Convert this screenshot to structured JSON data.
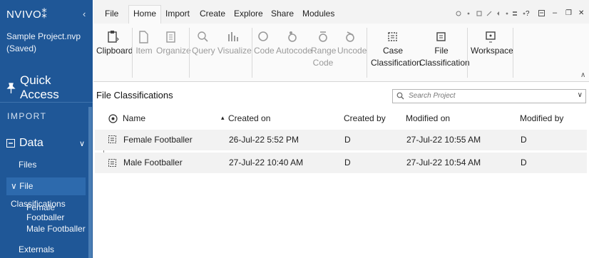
{
  "app": {
    "logo": "NVIVO",
    "logo_mark": "⁑",
    "collapse_glyph": "‹",
    "project_name": "Sample Project.nvp",
    "project_state": "(Saved)"
  },
  "sidebar": {
    "quick_access": "Quick Access",
    "section_import": "IMPORT",
    "data_label": "Data",
    "items": [
      {
        "label": "Files"
      },
      {
        "label": "File Classifications",
        "prefix": "∨"
      },
      {
        "label": "Female Footballer"
      },
      {
        "label": "Male Footballer"
      },
      {
        "label": "Externals"
      }
    ]
  },
  "ribbon": {
    "tabs": [
      {
        "label": "File"
      },
      {
        "label": "Home"
      },
      {
        "label": "Import"
      },
      {
        "label": "Create"
      },
      {
        "label": "Explore"
      },
      {
        "label": "Share"
      },
      {
        "label": "Modules"
      }
    ],
    "active_tab": "Home",
    "buttons": {
      "clipboard": "Clipboard",
      "item": "Item",
      "organize": "Organize",
      "query": "Query",
      "visualize": "Visualize",
      "code": "Code",
      "autocode": "Autocode",
      "range_code_1": "Range",
      "range_code_2": "Code",
      "uncode": "Uncode",
      "case_class_1": "Case",
      "case_class_2": "Classification",
      "file_class_1": "File",
      "file_class_2": "Classification",
      "workspace": "Workspace"
    },
    "window_controls": {
      "help": "?",
      "minimize": "–",
      "restore": "❐",
      "close": "✕"
    }
  },
  "content": {
    "title": "File Classifications",
    "search_placeholder": "Search Project",
    "columns": {
      "name": "Name",
      "created_on": "Created on",
      "created_by": "Created by",
      "modified_on": "Modified on",
      "modified_by": "Modified by"
    },
    "sort_indicator": "▴",
    "rows": [
      {
        "name": "Female Footballer",
        "created_on": "26-Jul-22 5:52 PM",
        "created_by": "D",
        "modified_on": "27-Jul-22 10:55 AM",
        "modified_by": "D"
      },
      {
        "name": "Male Footballer",
        "created_on": "27-Jul-22 10:40 AM",
        "created_by": "D",
        "modified_on": "27-Jul-22 10:54 AM",
        "modified_by": "D"
      }
    ]
  },
  "colors": {
    "sidebar": "#1f5797",
    "sidebar_selected": "#2d6aad",
    "row_bg": "#f2f2f2"
  }
}
